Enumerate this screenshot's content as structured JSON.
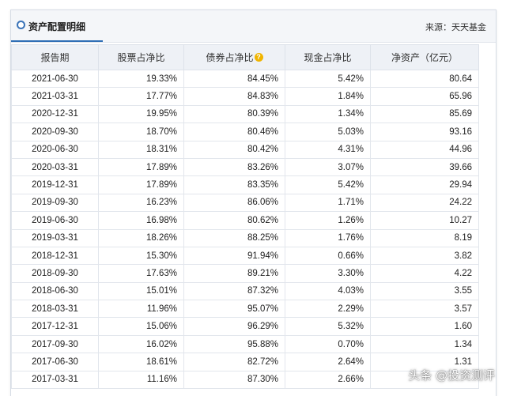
{
  "header": {
    "title": "资产配置明细",
    "source": "来源：天天基金"
  },
  "table": {
    "columns": [
      "报告期",
      "股票占净比",
      "债券占净比",
      "现金占净比",
      "净资产（亿元）"
    ],
    "help_icon": "question-mark-icon",
    "rows": [
      [
        "2021-06-30",
        "19.33%",
        "84.45%",
        "5.42%",
        "80.64"
      ],
      [
        "2021-03-31",
        "17.77%",
        "84.83%",
        "1.84%",
        "65.96"
      ],
      [
        "2020-12-31",
        "19.95%",
        "80.39%",
        "1.34%",
        "85.69"
      ],
      [
        "2020-09-30",
        "18.70%",
        "80.46%",
        "5.03%",
        "93.16"
      ],
      [
        "2020-06-30",
        "18.31%",
        "80.42%",
        "4.31%",
        "44.96"
      ],
      [
        "2020-03-31",
        "17.89%",
        "83.26%",
        "3.07%",
        "39.66"
      ],
      [
        "2019-12-31",
        "17.89%",
        "83.35%",
        "5.42%",
        "29.94"
      ],
      [
        "2019-09-30",
        "16.23%",
        "86.06%",
        "1.71%",
        "24.22"
      ],
      [
        "2019-06-30",
        "16.98%",
        "80.62%",
        "1.26%",
        "10.27"
      ],
      [
        "2019-03-31",
        "18.26%",
        "88.25%",
        "1.76%",
        "8.19"
      ],
      [
        "2018-12-31",
        "15.30%",
        "91.94%",
        "0.66%",
        "3.82"
      ],
      [
        "2018-09-30",
        "17.63%",
        "89.21%",
        "3.30%",
        "4.22"
      ],
      [
        "2018-06-30",
        "15.01%",
        "87.32%",
        "4.03%",
        "3.55"
      ],
      [
        "2018-03-31",
        "11.96%",
        "95.07%",
        "2.29%",
        "3.57"
      ],
      [
        "2017-12-31",
        "15.06%",
        "96.29%",
        "5.32%",
        "1.60"
      ],
      [
        "2017-09-30",
        "16.02%",
        "95.88%",
        "0.70%",
        "1.34"
      ],
      [
        "2017-06-30",
        "18.61%",
        "82.72%",
        "2.64%",
        "1.31"
      ],
      [
        "2017-03-31",
        "11.16%",
        "87.30%",
        "2.66%",
        ""
      ]
    ]
  },
  "watermark": {
    "text": "头条 @投资测评"
  },
  "colors": {
    "accent": "#2f6fb5",
    "header_bg": "#f4f6f9",
    "help_icon": "#f0b400"
  }
}
